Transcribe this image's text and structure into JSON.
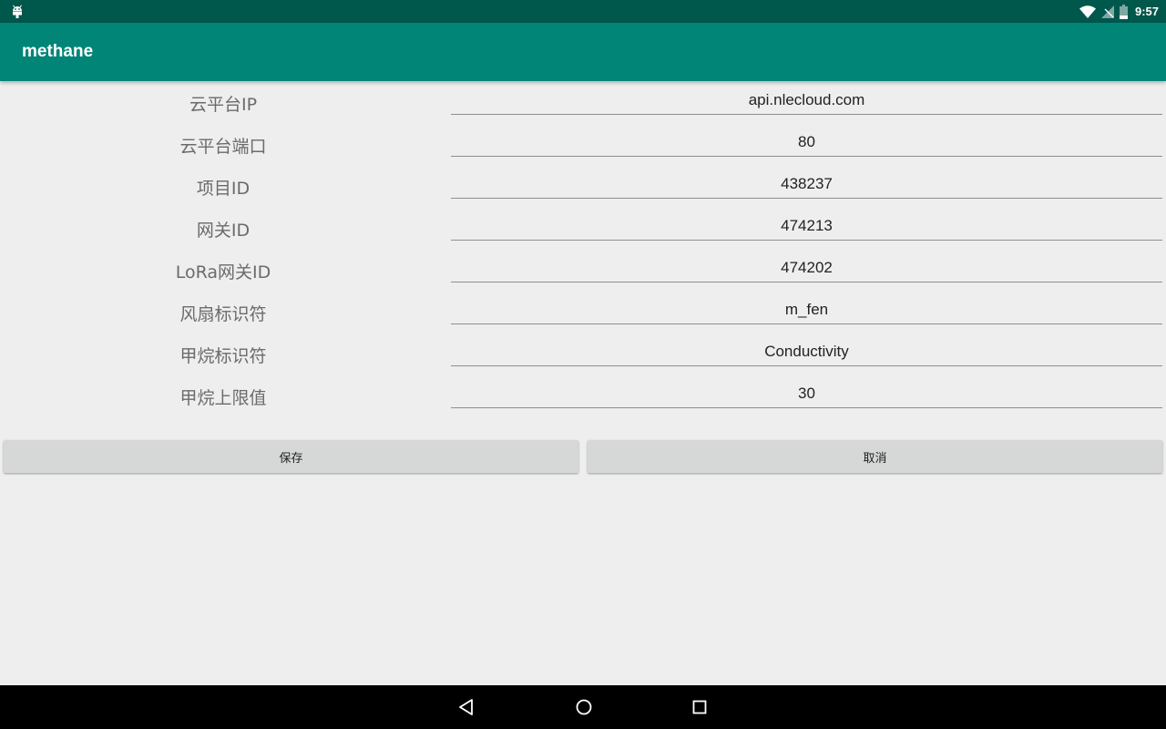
{
  "status_bar": {
    "time": "9:57",
    "icons": [
      "android-debug-icon",
      "wifi-icon",
      "no-signal-icon",
      "battery-icon"
    ]
  },
  "app_bar": {
    "title": "methane"
  },
  "form": {
    "rows": [
      {
        "label": "云平台IP",
        "value": "api.nlecloud.com"
      },
      {
        "label": "云平台端口",
        "value": "80"
      },
      {
        "label": "项目ID",
        "value": "438237"
      },
      {
        "label": "网关ID",
        "value": "474213"
      },
      {
        "label": "LoRa网关ID",
        "value": "474202"
      },
      {
        "label": "风扇标识符",
        "value": "m_fen"
      },
      {
        "label": "甲烷标识符",
        "value": "Conductivity"
      },
      {
        "label": "甲烷上限值",
        "value": "30"
      }
    ]
  },
  "buttons": {
    "save": "保存",
    "cancel": "取消"
  },
  "nav_bar": {
    "icons": [
      "back-icon",
      "home-icon",
      "recent-apps-icon"
    ]
  },
  "colors": {
    "status_bar": "#00574b",
    "app_bar": "#008577",
    "background": "#eeeeee",
    "button": "#d6d7d7",
    "nav_bar": "#000000"
  }
}
